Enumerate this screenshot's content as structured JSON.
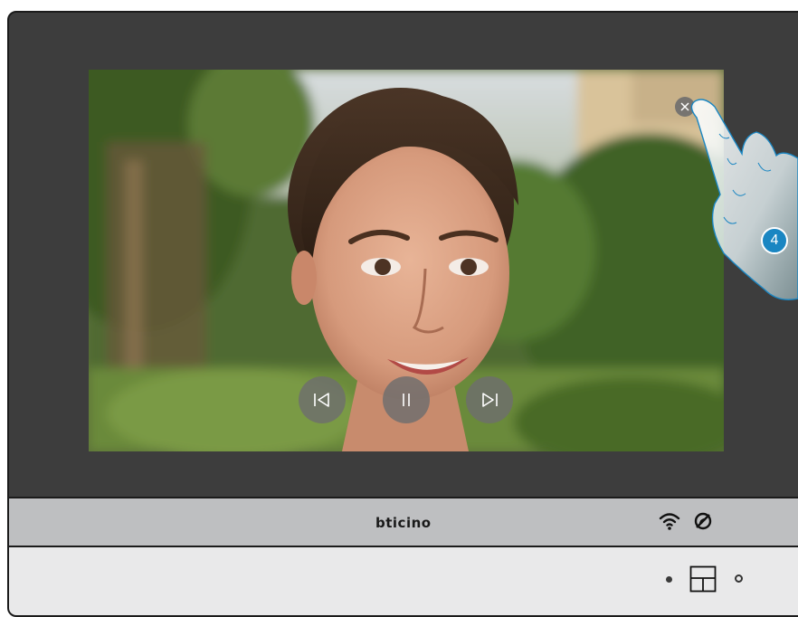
{
  "brand": {
    "logo_text": "bticino"
  },
  "video": {
    "content": "visitor-video-feed",
    "controls": [
      {
        "name": "previous-button",
        "icon": "skip-previous-icon"
      },
      {
        "name": "pause-button",
        "icon": "pause-icon"
      },
      {
        "name": "next-button",
        "icon": "skip-next-icon"
      }
    ],
    "close_icon": "close-icon"
  },
  "status": {
    "icons": [
      "wifi-icon",
      "do-not-disturb-icon"
    ]
  },
  "callout": {
    "step_number": "4"
  },
  "colors": {
    "bezel": "#3d3d3d",
    "bar": "#bebfc1",
    "base": "#e9e9ea",
    "badge": "#1a86c2"
  }
}
